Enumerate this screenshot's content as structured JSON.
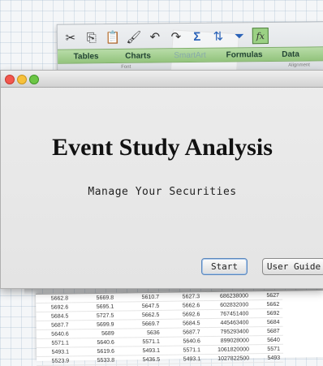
{
  "ribbon": {
    "toolbar_icons": [
      "cut-icon",
      "copy-icon",
      "paste-icon",
      "format-painter-icon",
      "undo-icon",
      "redo-icon",
      "autosum-icon",
      "sort-icon",
      "filter-icon",
      "fx-icon"
    ],
    "fx_label": "fx",
    "tabs": [
      "Tables",
      "Charts",
      "SmartArt",
      "Formulas",
      "Data"
    ],
    "sub_labels": [
      "Font",
      "Alignment"
    ]
  },
  "window": {
    "title": "Event Study Analysis",
    "subtitle": "Manage Your Securities",
    "start_label": "Start",
    "guide_label": "User Guide"
  },
  "sheet": {
    "rows": [
      [
        "5662.8",
        "5669.8",
        "5610.7",
        "5627.3",
        "686238000",
        "5627"
      ],
      [
        "5692.6",
        "5695.1",
        "5647.5",
        "5662.6",
        "602832000",
        "5662"
      ],
      [
        "5684.5",
        "5727.5",
        "5662.5",
        "5692.6",
        "767451400",
        "5692"
      ],
      [
        "5687.7",
        "5699.9",
        "5669.7",
        "5684.5",
        "445463400",
        "5684"
      ],
      [
        "5640.6",
        "5689",
        "5636",
        "5687.7",
        "795293400",
        "5687"
      ],
      [
        "5571.1",
        "5640.6",
        "5571.1",
        "5640.6",
        "899028000",
        "5640"
      ],
      [
        "5493.1",
        "5619.6",
        "5493.1",
        "5571.1",
        "1061820000",
        "5571"
      ],
      [
        "5523.9",
        "5533.8",
        "5436.5",
        "5493.1",
        "1027822500",
        "5493"
      ]
    ]
  }
}
